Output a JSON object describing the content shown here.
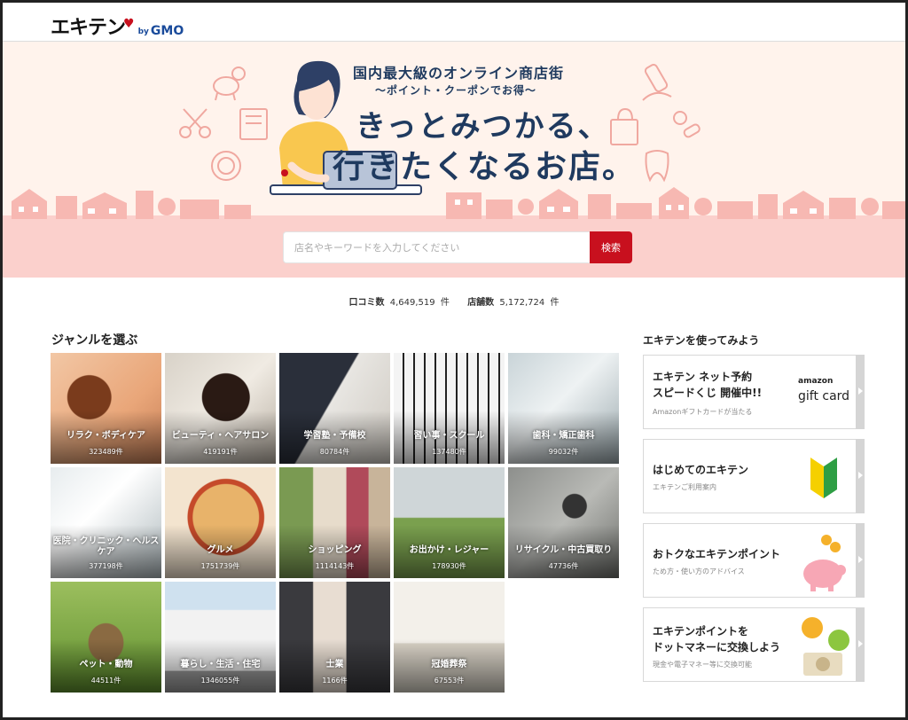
{
  "header": {
    "logo_main": "エキテン",
    "logo_by": "by",
    "logo_gmo": "GMO"
  },
  "hero": {
    "sub1": "国内最大級のオンライン商店街",
    "sub2": "～ポイント・クーポンでお得～",
    "main1": "きっとみつかる、",
    "main2": "行きたくなるお店。"
  },
  "search": {
    "placeholder": "店名やキーワードを入力してください",
    "button_label": "検索"
  },
  "stats": {
    "reviews_label": "口コミ数",
    "reviews_value": "4,649,519",
    "stores_label": "店舗数",
    "stores_value": "5,172,724",
    "unit": "件"
  },
  "genres": {
    "title": "ジャンルを選ぶ",
    "items": [
      {
        "name": "リラク・ボディケア",
        "count": "323489件"
      },
      {
        "name": "ビューティ・ヘアサロン",
        "count": "419191件"
      },
      {
        "name": "学習塾・予備校",
        "count": "80784件"
      },
      {
        "name": "習い事・スクール",
        "count": "137480件"
      },
      {
        "name": "歯科・矯正歯科",
        "count": "99032件"
      },
      {
        "name": "医院・クリニック・ヘルスケア",
        "count": "377198件"
      },
      {
        "name": "グルメ",
        "count": "1751739件"
      },
      {
        "name": "ショッピング",
        "count": "1114143件"
      },
      {
        "name": "お出かけ・レジャー",
        "count": "178930件"
      },
      {
        "name": "リサイクル・中古買取り",
        "count": "47736件"
      },
      {
        "name": "ペット・動物",
        "count": "44511件"
      },
      {
        "name": "暮らし・生活・住宅",
        "count": "1346055件"
      },
      {
        "name": "士業",
        "count": "1166件"
      },
      {
        "name": "冠婚葬祭",
        "count": "67553件"
      }
    ]
  },
  "sidebar": {
    "title": "エキテンを使ってみよう",
    "cards": [
      {
        "line1": "エキテン ネット予約",
        "line2": "スピードくじ 開催中!!",
        "sub": "Amazonギフトカードが当たる",
        "art_top": "amazon",
        "art_bottom": "gift card"
      },
      {
        "line1": "はじめてのエキテン",
        "line2": "",
        "sub": "エキテンご利用案内"
      },
      {
        "line1": "おトクなエキテンポイント",
        "line2": "",
        "sub": "ため方・使い方のアドバイス"
      },
      {
        "line1": "エキテンポイントを",
        "line2": "ドットマネーに交換しよう",
        "sub": "現金や電子マネー等に交換可能"
      }
    ]
  },
  "colors": {
    "brand_red": "#c8101e",
    "hero_bg": "#fff3ec",
    "hero_pink": "#fbd0cc",
    "navy": "#1f3a5f"
  }
}
